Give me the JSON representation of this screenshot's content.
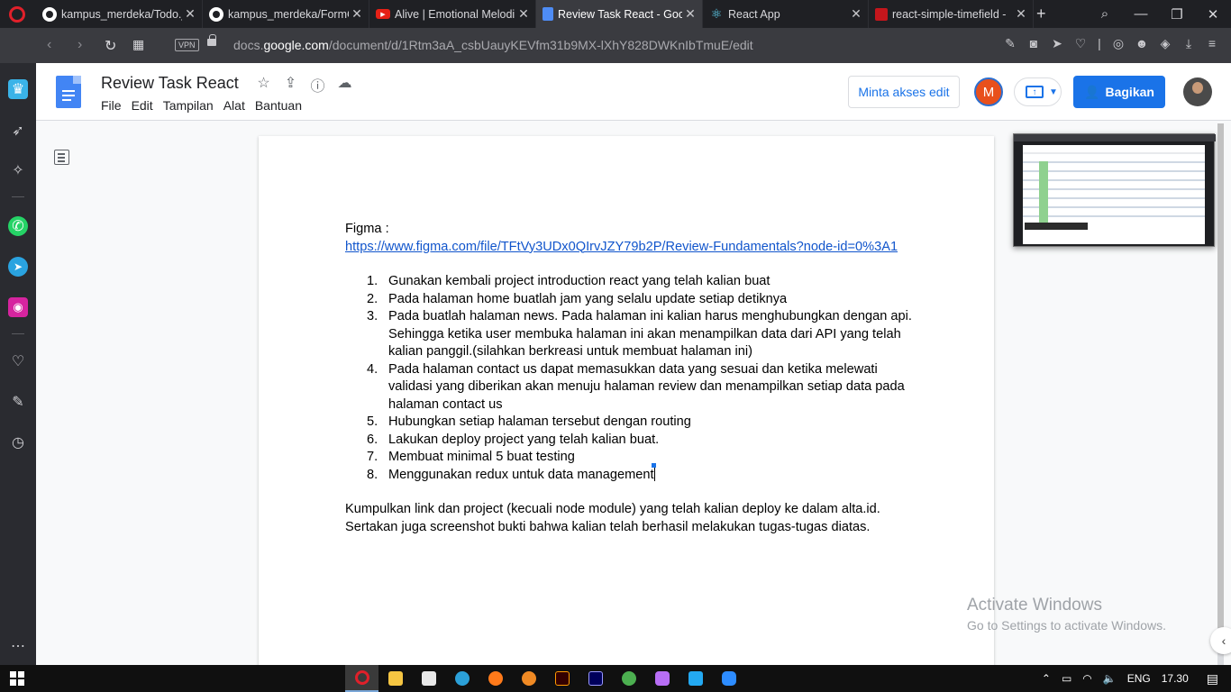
{
  "browser": {
    "tabs": [
      {
        "title": "kampus_merdeka/Todo.j",
        "favicon": "github-icon",
        "active": false
      },
      {
        "title": "kampus_merdeka/FormC",
        "favicon": "github-icon",
        "active": false
      },
      {
        "title": "Alive | Emotional Melodi",
        "favicon": "youtube-icon",
        "active": false
      },
      {
        "title": "Review Task React - Goo",
        "favicon": "docs-icon",
        "active": true
      },
      {
        "title": "React App",
        "favicon": "react-icon",
        "active": false
      },
      {
        "title": "react-simple-timefield - ",
        "favicon": "red-square-icon",
        "active": false
      }
    ],
    "new_tab_symbol": "+",
    "vpn_label": "VPN",
    "url_prefix": "docs.",
    "url_domain": "google.com",
    "url_path": "/document/d/1Rtm3aA_csbUauyKEVfm31b9MX-lXhY828DWKnIbTmuE/edit"
  },
  "docs": {
    "title": "Review Task React",
    "menu": [
      "File",
      "Edit",
      "Tampilan",
      "Alat",
      "Bantuan"
    ],
    "request_edit_label": "Minta akses edit",
    "avatar_initial": "M",
    "share_label": "Bagikan",
    "colors": {
      "accent": "#1a73e8",
      "avatar": "#e8501c",
      "link": "#1155cc"
    }
  },
  "document": {
    "figma_label": "Figma :",
    "figma_link": "https://www.figma.com/file/TFtVy3UDx0QIrvJZY79b2P/Review-Fundamentals?node-id=0%3A1",
    "items": [
      {
        "num": "1.",
        "text": "Gunakan kembali project introduction react yang telah kalian buat"
      },
      {
        "num": "2.",
        "text": "Pada halaman home buatlah jam yang selalu update setiap detiknya"
      },
      {
        "num": "3.",
        "text": "Pada buatlah halaman news. Pada halaman ini kalian harus menghubungkan dengan api. Sehingga ketika user membuka halaman ini akan menampilkan data dari API yang telah kalian panggil.(silahkan berkreasi untuk membuat halaman ini)"
      },
      {
        "num": "4.",
        "text": "Pada halaman contact us dapat memasukkan data yang sesuai dan ketika melewati validasi yang diberikan akan menuju halaman review dan menampilkan setiap data pada halaman contact us"
      },
      {
        "num": "5.",
        "text": "Hubungkan setiap halaman tersebut dengan routing"
      },
      {
        "num": "6.",
        "text": "Lakukan deploy project yang telah kalian buat."
      },
      {
        "num": "7.",
        "text": "Membuat minimal 5 buat testing"
      },
      {
        "num": "8.",
        "text": "Menggunakan redux untuk data management"
      }
    ],
    "closing_line1": "Kumpulkan link dan project (kecuali node module) yang telah kalian deploy ke dalam alta.id.",
    "closing_line2": "Sertakan juga screenshot bukti bahwa kalian telah berhasil melakukan tugas-tugas diatas."
  },
  "watermark": {
    "line1": "Activate Windows",
    "line2": "Go to Settings to activate Windows."
  },
  "taskbar": {
    "language": "ENG",
    "time": "17.30"
  }
}
